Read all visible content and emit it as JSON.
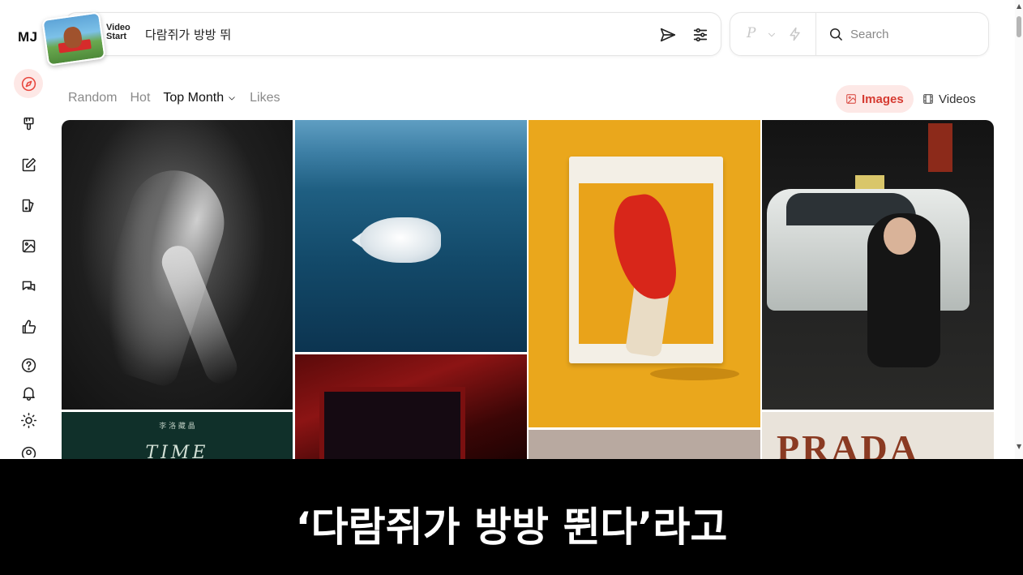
{
  "app": {
    "logo": "MJ"
  },
  "sidebar": {
    "items": [
      {
        "icon": "compass-icon",
        "active": true
      },
      {
        "icon": "paintbrush-icon",
        "active": false
      },
      {
        "icon": "edit-icon",
        "active": false
      },
      {
        "icon": "palette-icon",
        "active": false
      },
      {
        "icon": "image-icon",
        "active": false
      },
      {
        "icon": "chat-icon",
        "active": false
      },
      {
        "icon": "thumbs-up-icon",
        "active": false
      },
      {
        "icon": "help-icon",
        "active": false
      },
      {
        "icon": "bell-icon",
        "active": false
      },
      {
        "icon": "sun-icon",
        "active": false
      },
      {
        "icon": "profile-icon",
        "active": false
      }
    ]
  },
  "prompt": {
    "video_start_line1": "Video",
    "video_start_line2": "Start",
    "text": "다람쥐가 방방 뛰"
  },
  "toolbar": {
    "model_letter": "P",
    "search_placeholder": "Search"
  },
  "filters": {
    "tabs": [
      {
        "label": "Random",
        "active": false
      },
      {
        "label": "Hot",
        "active": false
      },
      {
        "label": "Top Month",
        "active": true,
        "dropdown": true
      },
      {
        "label": "Likes",
        "active": false
      }
    ]
  },
  "media": {
    "images_label": "Images",
    "videos_label": "Videos",
    "active": "Images"
  },
  "gallery": {
    "tile_texts": {
      "time_small": "李 洛 藏 晶",
      "time_big": "TIME",
      "prada": "PRADA"
    }
  },
  "caption": {
    "text": "‘다람쥐가 방방 뛴다’라고"
  },
  "colors": {
    "accent": "#e8473e",
    "accent_bg": "#fde8e6"
  }
}
